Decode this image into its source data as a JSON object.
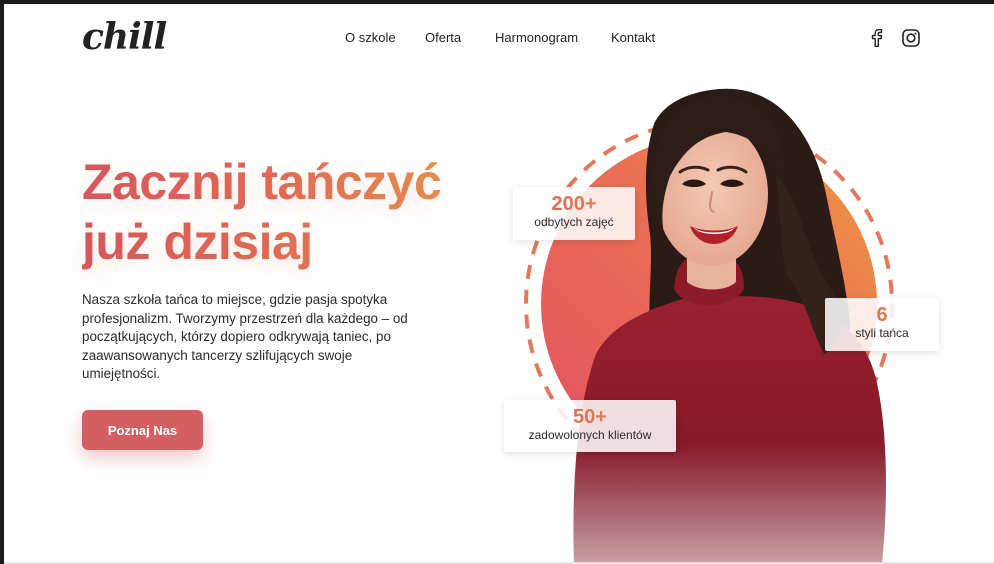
{
  "brand": {
    "logo_text": "chill"
  },
  "nav": {
    "items": [
      {
        "label": "O szkole"
      },
      {
        "label": "Oferta"
      },
      {
        "label": "Harmonogram"
      },
      {
        "label": "Kontakt"
      }
    ]
  },
  "social": {
    "icons": [
      "facebook-icon",
      "instagram-icon"
    ]
  },
  "hero": {
    "headline_line1": "Zacznij tańczyć",
    "headline_line2": "już dzisiaj",
    "description": "Nasza szkoła tańca to miejsce, gdzie pasja spotyka profesjonalizm. Tworzymy przestrzeń dla każdego – od początkujących, którzy dopiero odkrywają taniec, po zaawansowanych tancerzy szlifujących swoje umiejętności.",
    "cta_label": "Poznaj Nas"
  },
  "stats": [
    {
      "value": "200+",
      "label": "odbytych zajęć"
    },
    {
      "value": "6",
      "label": "styli tańca"
    },
    {
      "value": "50+",
      "label": "zadowolonych klientów"
    }
  ],
  "colors": {
    "accent": "#d45f63",
    "gradient_start": "#d6565d",
    "gradient_end": "#e89a4c",
    "dress": "#8e1c2a"
  }
}
